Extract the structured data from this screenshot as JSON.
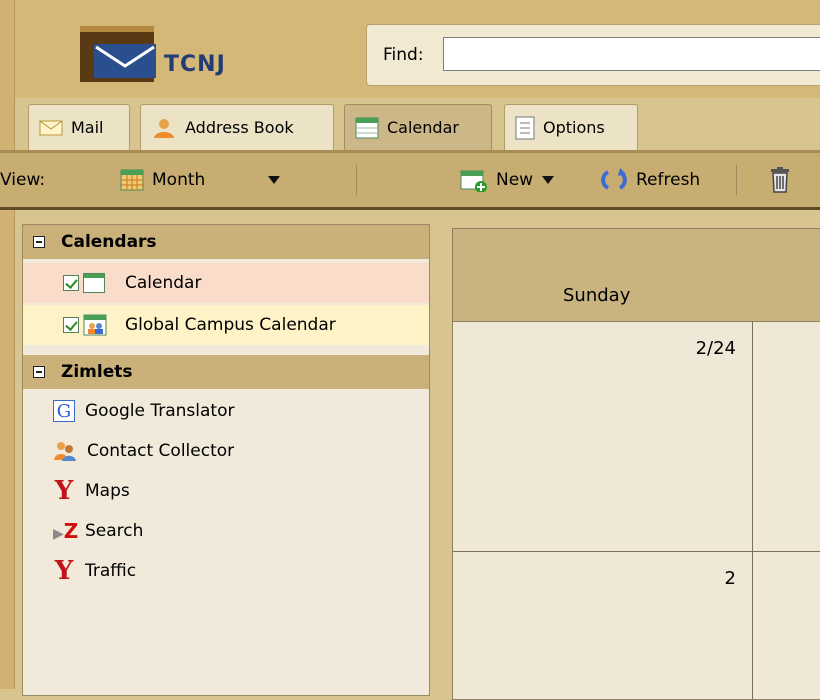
{
  "header": {
    "brand": "TCNJ",
    "find_label": "Find:",
    "find_value": ""
  },
  "tabs": [
    {
      "label": "Mail",
      "icon": "envelope-icon"
    },
    {
      "label": "Address Book",
      "icon": "address-book-icon"
    },
    {
      "label": "Calendar",
      "icon": "calendar-icon",
      "active": true
    },
    {
      "label": "Options",
      "icon": "options-icon"
    }
  ],
  "toolbar": {
    "view_label": "View:",
    "view_value": "Month",
    "new_label": "New",
    "refresh_label": "Refresh"
  },
  "sidebar": {
    "calendars_title": "Calendars",
    "calendars": [
      {
        "label": "Calendar",
        "checked": true
      },
      {
        "label": "Global Campus Calendar",
        "checked": true
      }
    ],
    "zimlets_title": "Zimlets",
    "zimlets": [
      {
        "label": "Google Translator",
        "icon": "google-g-icon"
      },
      {
        "label": "Contact Collector",
        "icon": "contacts-icon"
      },
      {
        "label": "Maps",
        "icon": "yahoo-y-icon"
      },
      {
        "label": "Search",
        "icon": "zimbra-z-icon"
      },
      {
        "label": "Traffic",
        "icon": "yahoo-y-icon"
      }
    ]
  },
  "calendar": {
    "day_header": "Sunday",
    "cells": [
      {
        "date": "2/24"
      },
      {
        "date": "2"
      }
    ]
  },
  "colors": {
    "header_bg": "#d4b877",
    "toolbar_bg": "#c7ad72",
    "panel_bg": "#f1eadb",
    "accent_check": "#2a8a22",
    "brand_blue": "#233c75"
  }
}
